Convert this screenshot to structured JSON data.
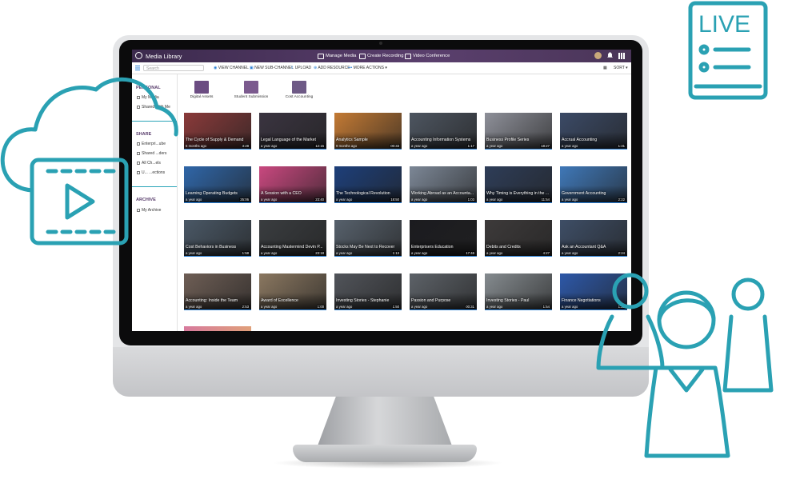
{
  "app": {
    "title": "Media Library",
    "nav": [
      "Manage Media",
      "Create Recording",
      "Video Conference"
    ]
  },
  "toolbar": {
    "search_placeholder": "Search",
    "actions": [
      "VIEW CHANNEL",
      "NEW SUB-CHANNEL",
      "UPLOAD",
      "ADD RESOURCE",
      "MORE ACTIONS"
    ],
    "sort_label": "SORT"
  },
  "sidebar": {
    "personal_heading": "PERSONAL",
    "personal_items": [
      "My Media",
      "Shared With Me"
    ],
    "shared_heading": "SHARE",
    "shared_items": [
      "Enterpri...ube",
      "Shared ...ders",
      "All Ch...els",
      "U... ...ections"
    ],
    "archive_heading": "ARCHIVE",
    "archive_items": [
      "My Archive"
    ]
  },
  "folders": [
    "Digital Assets",
    "Student Submission",
    "Cost Accounting"
  ],
  "videos": [
    {
      "title": "The Cycle of Supply & Demand",
      "meta": "6 months ago",
      "duration": "3:28",
      "color": "#8a3a3a"
    },
    {
      "title": "Legal Language of the Market",
      "meta": "a year ago",
      "duration": "12:15",
      "color": "#3a3440"
    },
    {
      "title": "Analytics Sample",
      "meta": "9 months ago",
      "duration": "00:33",
      "color": "#c37a34"
    },
    {
      "title": "Accounting Information Systems",
      "meta": "a year ago",
      "duration": "1:17",
      "color": "#4d5560"
    },
    {
      "title": "Business Profile Series",
      "meta": "a year ago",
      "duration": "18:27",
      "color": "#8e9099"
    },
    {
      "title": "Accrual Accounting",
      "meta": "a year ago",
      "duration": "1:31",
      "color": "#3b4a66"
    },
    {
      "title": "Learning Operating Budgets",
      "meta": "a year ago",
      "duration": "25:06",
      "color": "#2f66a8"
    },
    {
      "title": "A Session with a CEO",
      "meta": "a year ago",
      "duration": "23:40",
      "color": "#c9487f"
    },
    {
      "title": "The Technological Revolution",
      "meta": "a year ago",
      "duration": "18:50",
      "color": "#1d3f7a"
    },
    {
      "title": "Working Abroad as an Accounta...",
      "meta": "a year ago",
      "duration": "1:03",
      "color": "#7c8796"
    },
    {
      "title": "Why Timing is Everything in the ...",
      "meta": "a year ago",
      "duration": "11:54",
      "color": "#2e3d58"
    },
    {
      "title": "Government Accounting",
      "meta": "a year ago",
      "duration": "2:22",
      "color": "#3f78b8"
    },
    {
      "title": "Cost Behaviors in Business",
      "meta": "a year ago",
      "duration": "1:58",
      "color": "#4a5866"
    },
    {
      "title": "Accounting Mastermind Devin P...",
      "meta": "a year ago",
      "duration": "23:18",
      "color": "#3a3d40"
    },
    {
      "title": "Stocks May Be Next to Recover",
      "meta": "a year ago",
      "duration": "1:13",
      "color": "#57616c"
    },
    {
      "title": "Enterprisers Education",
      "meta": "a year ago",
      "duration": "17:46",
      "color": "#1b1b1f"
    },
    {
      "title": "Debits and Credits",
      "meta": "a year ago",
      "duration": "4:27",
      "color": "#3d3a3a"
    },
    {
      "title": "Ask an Accountant Q&A",
      "meta": "a year ago",
      "duration": "2:24",
      "color": "#3e4e66"
    },
    {
      "title": "Accounting: Inside the Team",
      "meta": "a year ago",
      "duration": "2:53",
      "color": "#6e5e55"
    },
    {
      "title": "Award of Excellence",
      "meta": "a year ago",
      "duration": "1:00",
      "color": "#8a7760"
    },
    {
      "title": "Investing Stories - Stephanie",
      "meta": "a year ago",
      "duration": "1:50",
      "color": "#51545a"
    },
    {
      "title": "Passion and Purpose",
      "meta": "a year ago",
      "duration": "00:31",
      "color": "#5d6268"
    },
    {
      "title": "Investing Stories - Paul",
      "meta": "a year ago",
      "duration": "1:54",
      "color": "#858b8f"
    },
    {
      "title": "Finance Negotiations",
      "meta": "a year ago",
      "duration": "1:21",
      "color": "#2d58a8"
    }
  ],
  "decor": {
    "live_label": "LIVE",
    "accent": "#2aa1b3",
    "brand_purple": "#5a3f6d"
  }
}
